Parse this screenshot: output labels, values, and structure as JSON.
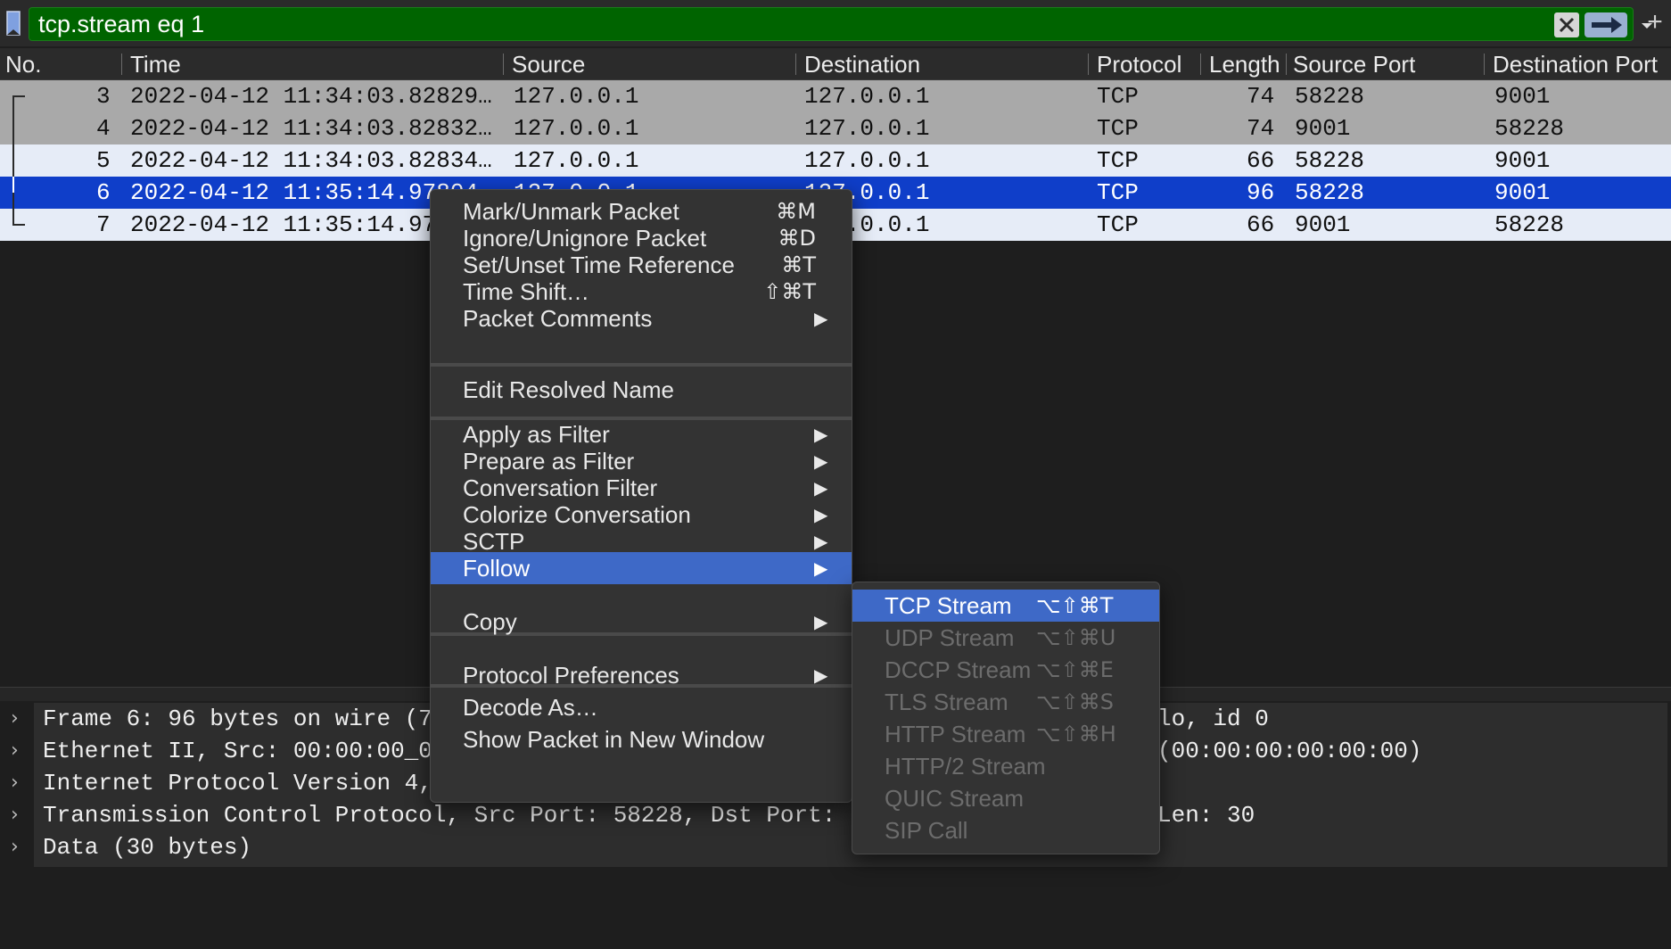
{
  "filter": {
    "value": "tcp.stream eq 1",
    "add_label": "+"
  },
  "columns": [
    "No.",
    "Time",
    "Source",
    "Destination",
    "Protocol",
    "Length",
    "Source Port",
    "Destination Port"
  ],
  "packets": [
    {
      "no": "3",
      "time": "2022-04-12 11:34:03.82829…",
      "src": "127.0.0.1",
      "dst": "127.0.0.1",
      "proto": "TCP",
      "len": "74",
      "sport": "58228",
      "dport": "9001"
    },
    {
      "no": "4",
      "time": "2022-04-12 11:34:03.82832…",
      "src": "127.0.0.1",
      "dst": "127.0.0.1",
      "proto": "TCP",
      "len": "74",
      "sport": "9001",
      "dport": "58228"
    },
    {
      "no": "5",
      "time": "2022-04-12 11:34:03.82834…",
      "src": "127.0.0.1",
      "dst": "127.0.0.1",
      "proto": "TCP",
      "len": "66",
      "sport": "58228",
      "dport": "9001"
    },
    {
      "no": "6",
      "time": "2022-04-12 11:35:14.97804…",
      "src": "127.0.0.1",
      "dst": "127.0.0.1",
      "proto": "TCP",
      "len": "96",
      "sport": "58228",
      "dport": "9001"
    },
    {
      "no": "7",
      "time": "2022-04-12 11:35:14.97",
      "src": "127.0.0.1",
      "dst": "127.0.0.1",
      "proto": "TCP",
      "len": "66",
      "sport": "9001",
      "dport": "58228"
    }
  ],
  "details": [
    {
      "text": "Frame 6: 96 bytes on wire (7",
      "right": "lo, id 0"
    },
    {
      "text": "Ethernet II, Src: 00:00:00_0",
      "right": "(00:00:00:00:00:00)"
    },
    {
      "text": "Internet Protocol Version 4,",
      "right": ""
    },
    {
      "text": "Transmission Control Protocol, Src Port: 58228, Dst Port:",
      "right": "Len: 30"
    },
    {
      "text": "Data (30 bytes)",
      "right": ""
    }
  ],
  "context_menu": {
    "items": [
      {
        "label": "Mark/Unmark Packet",
        "shortcut": "⌘M"
      },
      {
        "label": "Ignore/Unignore Packet",
        "shortcut": "⌘D"
      },
      {
        "label": "Set/Unset Time Reference",
        "shortcut": "⌘T"
      },
      {
        "label": "Time Shift…",
        "shortcut": "⇧⌘T"
      },
      {
        "label": "Packet Comments",
        "arrow": "▶"
      },
      {
        "label": "Edit Resolved Name"
      },
      {
        "label": "Apply as Filter",
        "arrow": "▶"
      },
      {
        "label": "Prepare as Filter",
        "arrow": "▶"
      },
      {
        "label": "Conversation Filter",
        "arrow": "▶"
      },
      {
        "label": "Colorize Conversation",
        "arrow": "▶"
      },
      {
        "label": "SCTP",
        "arrow": "▶"
      },
      {
        "label": "Follow",
        "arrow": "▶"
      },
      {
        "label": "Copy",
        "arrow": "▶"
      },
      {
        "label": "Protocol Preferences",
        "arrow": "▶"
      },
      {
        "label": "Decode As…"
      },
      {
        "label": "Show Packet in New Window"
      }
    ]
  },
  "follow_submenu": {
    "items": [
      {
        "label": "TCP Stream",
        "shortcut": "⌥⇧⌘T",
        "enabled": true
      },
      {
        "label": "UDP Stream",
        "shortcut": "⌥⇧⌘U",
        "enabled": false
      },
      {
        "label": "DCCP Stream",
        "shortcut": "⌥⇧⌘E",
        "enabled": false
      },
      {
        "label": "TLS Stream",
        "shortcut": "⌥⇧⌘S",
        "enabled": false
      },
      {
        "label": "HTTP Stream",
        "shortcut": "⌥⇧⌘H",
        "enabled": false
      },
      {
        "label": "HTTP/2 Stream",
        "shortcut": "",
        "enabled": false
      },
      {
        "label": "QUIC Stream",
        "shortcut": "",
        "enabled": false
      },
      {
        "label": "SIP Call",
        "shortcut": "",
        "enabled": false
      }
    ]
  },
  "colors": {
    "filter_valid": "#006400",
    "selected_row": "#0f3ec9",
    "menu_highlight": "#3e69c7"
  }
}
